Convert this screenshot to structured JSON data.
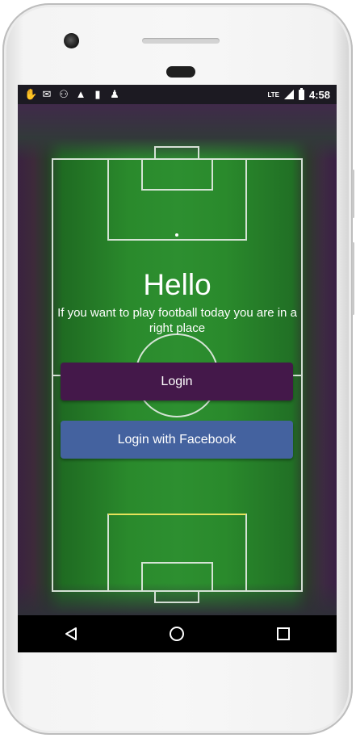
{
  "status_bar": {
    "left_icons": [
      "hand-icon",
      "gmail-icon",
      "arch-icon",
      "warning-icon",
      "sd-card-icon",
      "person-icon"
    ],
    "network": "LTE",
    "time": "4:58"
  },
  "main": {
    "title": "Hello",
    "subtitle": "If you want to play football today you are in a right place",
    "login_label": "Login",
    "facebook_label": "Login with Facebook"
  },
  "nav_bar": {
    "icons": [
      "back-icon",
      "home-icon",
      "recents-icon"
    ]
  },
  "colors": {
    "login_button": "#44184a",
    "facebook_button": "#44629f",
    "field_green": "#2a8a2c"
  }
}
